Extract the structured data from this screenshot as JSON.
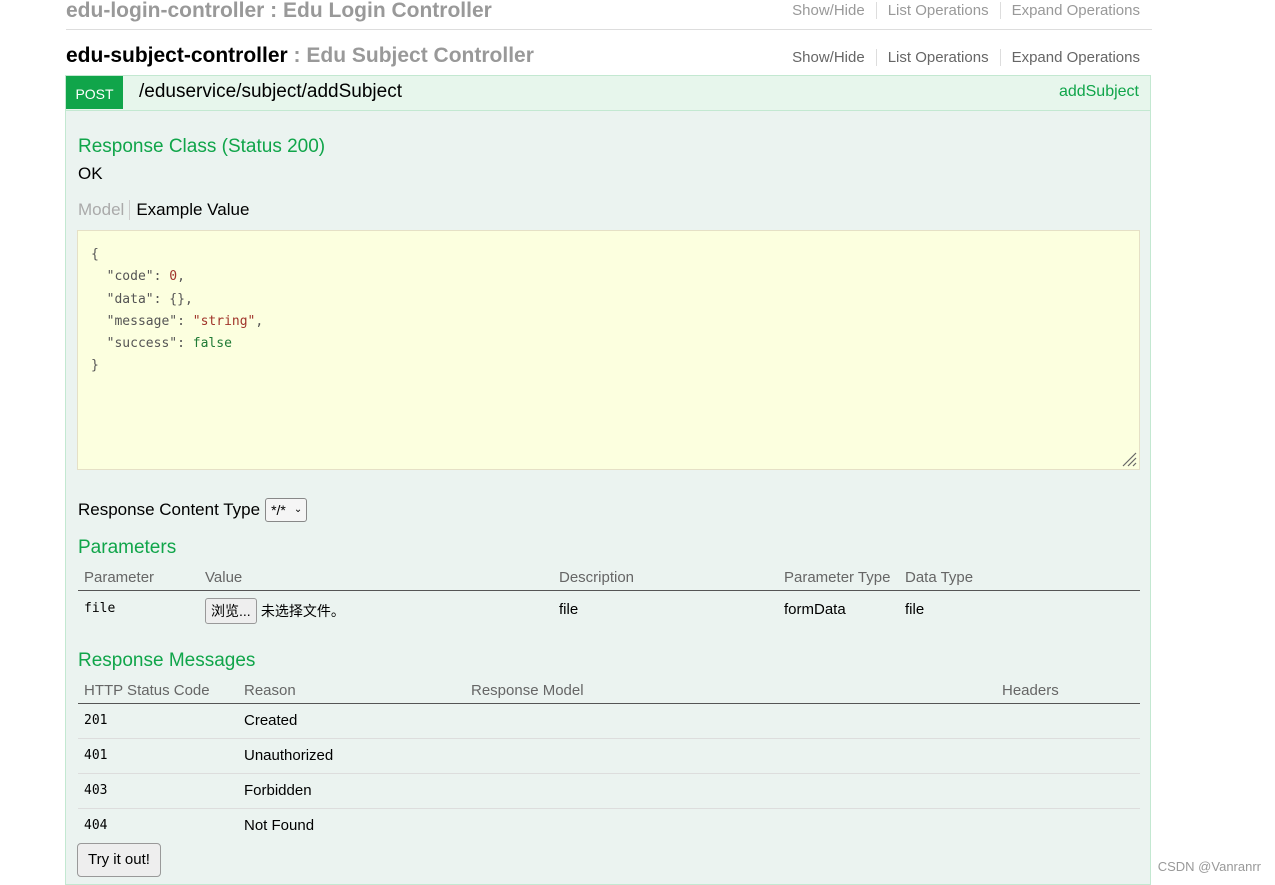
{
  "prev_controller": {
    "name": "edu-login-controller",
    "separator": " : ",
    "description": "Edu Login Controller",
    "ops": [
      "Show/Hide",
      "List Operations",
      "Expand Operations"
    ]
  },
  "controller": {
    "name": "edu-subject-controller",
    "separator": " : ",
    "description": "Edu Subject Controller",
    "ops": [
      "Show/Hide",
      "List Operations",
      "Expand Operations"
    ]
  },
  "operation": {
    "method": "POST",
    "path": "/eduservice/subject/addSubject",
    "nickname": "addSubject",
    "colors": {
      "verb": "#10a54a",
      "accent": "#10a54a",
      "example_bg": "#fcffdf"
    }
  },
  "response_class": {
    "heading": "Response Class (Status 200)",
    "value": "OK",
    "tabs": [
      "Model",
      "Example Value"
    ]
  },
  "example_value": {
    "open": "{",
    "code_key": "\"code\"",
    "code_val": "0",
    "data_key": "\"data\"",
    "data_val": "{}",
    "message_key": "\"message\"",
    "message_val": "\"string\"",
    "success_key": "\"success\"",
    "success_val": "false",
    "close": "}"
  },
  "response_content_type": {
    "label": "Response Content Type",
    "selected": "*/*"
  },
  "parameters": {
    "heading": "Parameters",
    "columns": [
      "Parameter",
      "Value",
      "Description",
      "Parameter Type",
      "Data Type"
    ],
    "rows": [
      {
        "name": "file",
        "browse": "浏览...",
        "no_file": "未选择文件。",
        "description": "file",
        "param_type": "formData",
        "data_type": "file"
      }
    ]
  },
  "response_messages": {
    "heading": "Response Messages",
    "columns": [
      "HTTP Status Code",
      "Reason",
      "Response Model",
      "Headers"
    ],
    "rows": [
      {
        "code": "201",
        "reason": "Created"
      },
      {
        "code": "401",
        "reason": "Unauthorized"
      },
      {
        "code": "403",
        "reason": "Forbidden"
      },
      {
        "code": "404",
        "reason": "Not Found"
      }
    ]
  },
  "try_button": "Try it out!",
  "watermark": "CSDN @Vanranrr"
}
